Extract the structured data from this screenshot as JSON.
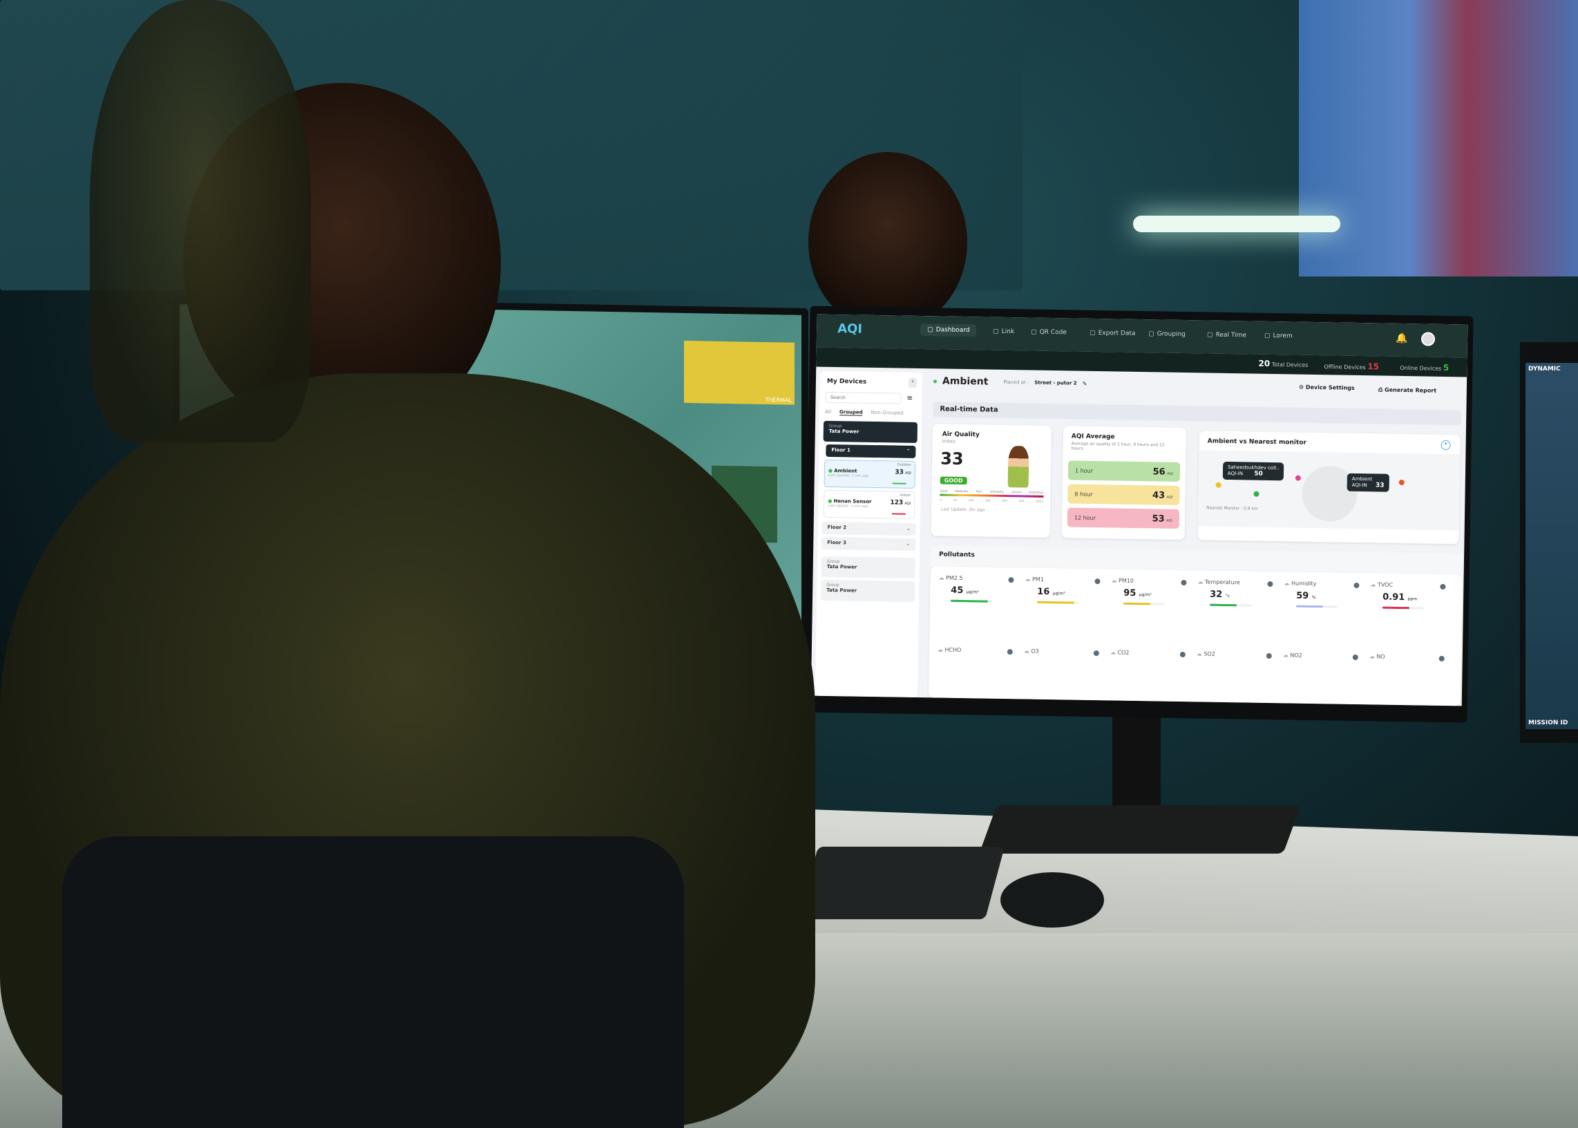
{
  "scene": {
    "left_monitor": {
      "tag": "THERMAL"
    },
    "right_monitor": {
      "top": "DYNAMIC",
      "bottom": "MISSION ID"
    }
  },
  "app": {
    "logo": "AQI",
    "nav": [
      {
        "label": "Dashboard",
        "icon": "grid-icon",
        "active": true
      },
      {
        "label": "Link",
        "icon": "link-icon"
      },
      {
        "label": "QR Code",
        "icon": "qr-icon"
      },
      {
        "label": "Export Data",
        "icon": "export-icon"
      },
      {
        "label": "Grouping",
        "icon": "grouping-icon"
      },
      {
        "label": "Real Time",
        "icon": "clock-icon"
      },
      {
        "label": "Lorem",
        "icon": "monitor-icon"
      }
    ],
    "stats": {
      "total": "20",
      "total_label": "Total Devices",
      "offline_label": "Offline Devices",
      "offline": "15",
      "online_label": "Online Devices",
      "online": "5"
    },
    "colors": {
      "offline": "#e53946",
      "online": "#3bbf4a",
      "header": "#1e3532"
    }
  },
  "sidebar": {
    "title": "My Devices",
    "search_placeholder": "Search",
    "tabs": [
      "All",
      "Grouped",
      "Non-Grouped"
    ],
    "group1": {
      "caption": "Group",
      "name": "Tata Power"
    },
    "floor1": "Floor 1",
    "devices": [
      {
        "name": "Ambient",
        "tag": "Outdoor",
        "value": "33",
        "unit": "AQI",
        "updated": "Last Update: 2 min ago"
      },
      {
        "name": "Henan Sensor",
        "tag": "Indoor",
        "value": "123",
        "unit": "AQI",
        "updated": "Last Update: 2 min ago"
      }
    ],
    "floor2": "Floor 2",
    "floor3": "Floor 3",
    "groups": [
      {
        "caption": "Group",
        "name": "Tata Power"
      },
      {
        "caption": "Group",
        "name": "Tata Power"
      }
    ]
  },
  "main": {
    "device": "Ambient",
    "placed_label": "Placed at :",
    "placed_path": "Street › putor 2",
    "device_settings": "Device Settings",
    "generate_report": "Generate Report",
    "section": "Real-time Data",
    "aqi": {
      "title": "Air Quality",
      "subtitle": "Index",
      "value": "33",
      "status": "GOOD",
      "scale_labels": [
        "Good",
        "Moderate",
        "Poor",
        "Unhealthy",
        "Severe",
        "Hazardous"
      ],
      "scale_ticks": [
        "0",
        "50",
        "100",
        "200",
        "300",
        "400",
        "500+"
      ],
      "updated": "Last Update: 2hr ago"
    },
    "avg": {
      "title": "AQI Average",
      "desc": "Average air quality of 1 hour, 8 hours and 12 hours.",
      "rows": [
        {
          "label": "1 hour",
          "value": "56",
          "unit": "AQI",
          "color": "#b9e0a5"
        },
        {
          "label": "8 hour",
          "value": "43",
          "unit": "AQI",
          "color": "#f7e39c"
        },
        {
          "label": "12 hour",
          "value": "53",
          "unit": "AQI",
          "color": "#f6b7c3"
        }
      ]
    },
    "map": {
      "title": "Ambient vs Nearest monitor",
      "tip1": {
        "name": "Saheedsukhdev coll..",
        "label": "AQI-IN",
        "value": "50"
      },
      "tip2": {
        "name": "Ambient",
        "label": "AQI-IN",
        "value": "33"
      },
      "nearest": "Nearest Monitor : 0.8 km"
    },
    "pollutants_title": "Pollutants",
    "pollutants": [
      {
        "name": "PM2.5",
        "value": "45",
        "unit": "µg/m³",
        "color": "#2db34a",
        "level": 0.9
      },
      {
        "name": "PM1",
        "value": "16",
        "unit": "µg/m³",
        "color": "#e8c21e",
        "level": 0.9
      },
      {
        "name": "PM10",
        "value": "95",
        "unit": "µg/m³",
        "color": "#e8c21e",
        "level": 0.65
      },
      {
        "name": "Temperature",
        "value": "32",
        "unit": "°c",
        "color": "#2db34a",
        "level": 0.65
      },
      {
        "name": "Humidity",
        "value": "59",
        "unit": "%",
        "color": "#a9b8ea",
        "level": 0.65
      },
      {
        "name": "TVOC",
        "value": "0.91",
        "unit": "ppm",
        "color": "#e0304e",
        "level": 0.65
      },
      {
        "name": "HCHO"
      },
      {
        "name": "O3"
      },
      {
        "name": "CO2"
      },
      {
        "name": "SO2"
      },
      {
        "name": "NO2"
      },
      {
        "name": "NO"
      }
    ]
  }
}
